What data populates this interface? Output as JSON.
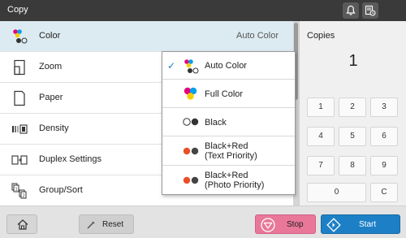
{
  "topbar": {
    "title": "Copy",
    "bell_icon": "bell-icon",
    "job_icon": "job-status-icon"
  },
  "menu": {
    "items": [
      {
        "label": "Color",
        "value": "Auto Color",
        "icon": "color-mode-icon"
      },
      {
        "label": "Zoom",
        "value": "",
        "icon": "zoom-icon"
      },
      {
        "label": "Paper",
        "value": "",
        "icon": "paper-icon"
      },
      {
        "label": "Density",
        "value": "",
        "icon": "density-icon"
      },
      {
        "label": "Duplex Settings",
        "value": "",
        "icon": "duplex-icon"
      },
      {
        "label": "Group/Sort",
        "value": "",
        "icon": "group-sort-icon"
      }
    ]
  },
  "color_dropdown": {
    "options": [
      {
        "label": "Auto Color",
        "selected": true
      },
      {
        "label": "Full Color",
        "selected": false
      },
      {
        "label": "Black",
        "selected": false
      },
      {
        "label_line1": "Black+Red",
        "label_line2": "(Text Priority)",
        "selected": false
      },
      {
        "label_line1": "Black+Red",
        "label_line2": "(Photo Priority)",
        "selected": false
      }
    ]
  },
  "copies": {
    "label": "Copies",
    "value": "1"
  },
  "keypad": {
    "keys": [
      "1",
      "2",
      "3",
      "4",
      "5",
      "6",
      "7",
      "8",
      "9",
      "0",
      "C"
    ]
  },
  "bottom": {
    "home_icon": "home-icon",
    "reset_label": "Reset",
    "stop_label": "Stop",
    "start_label": "Start"
  },
  "colors": {
    "accent": "#1d7fc1",
    "stop": "#e8779a",
    "start": "#1d80c6",
    "selected_row": "#dcebf1"
  }
}
